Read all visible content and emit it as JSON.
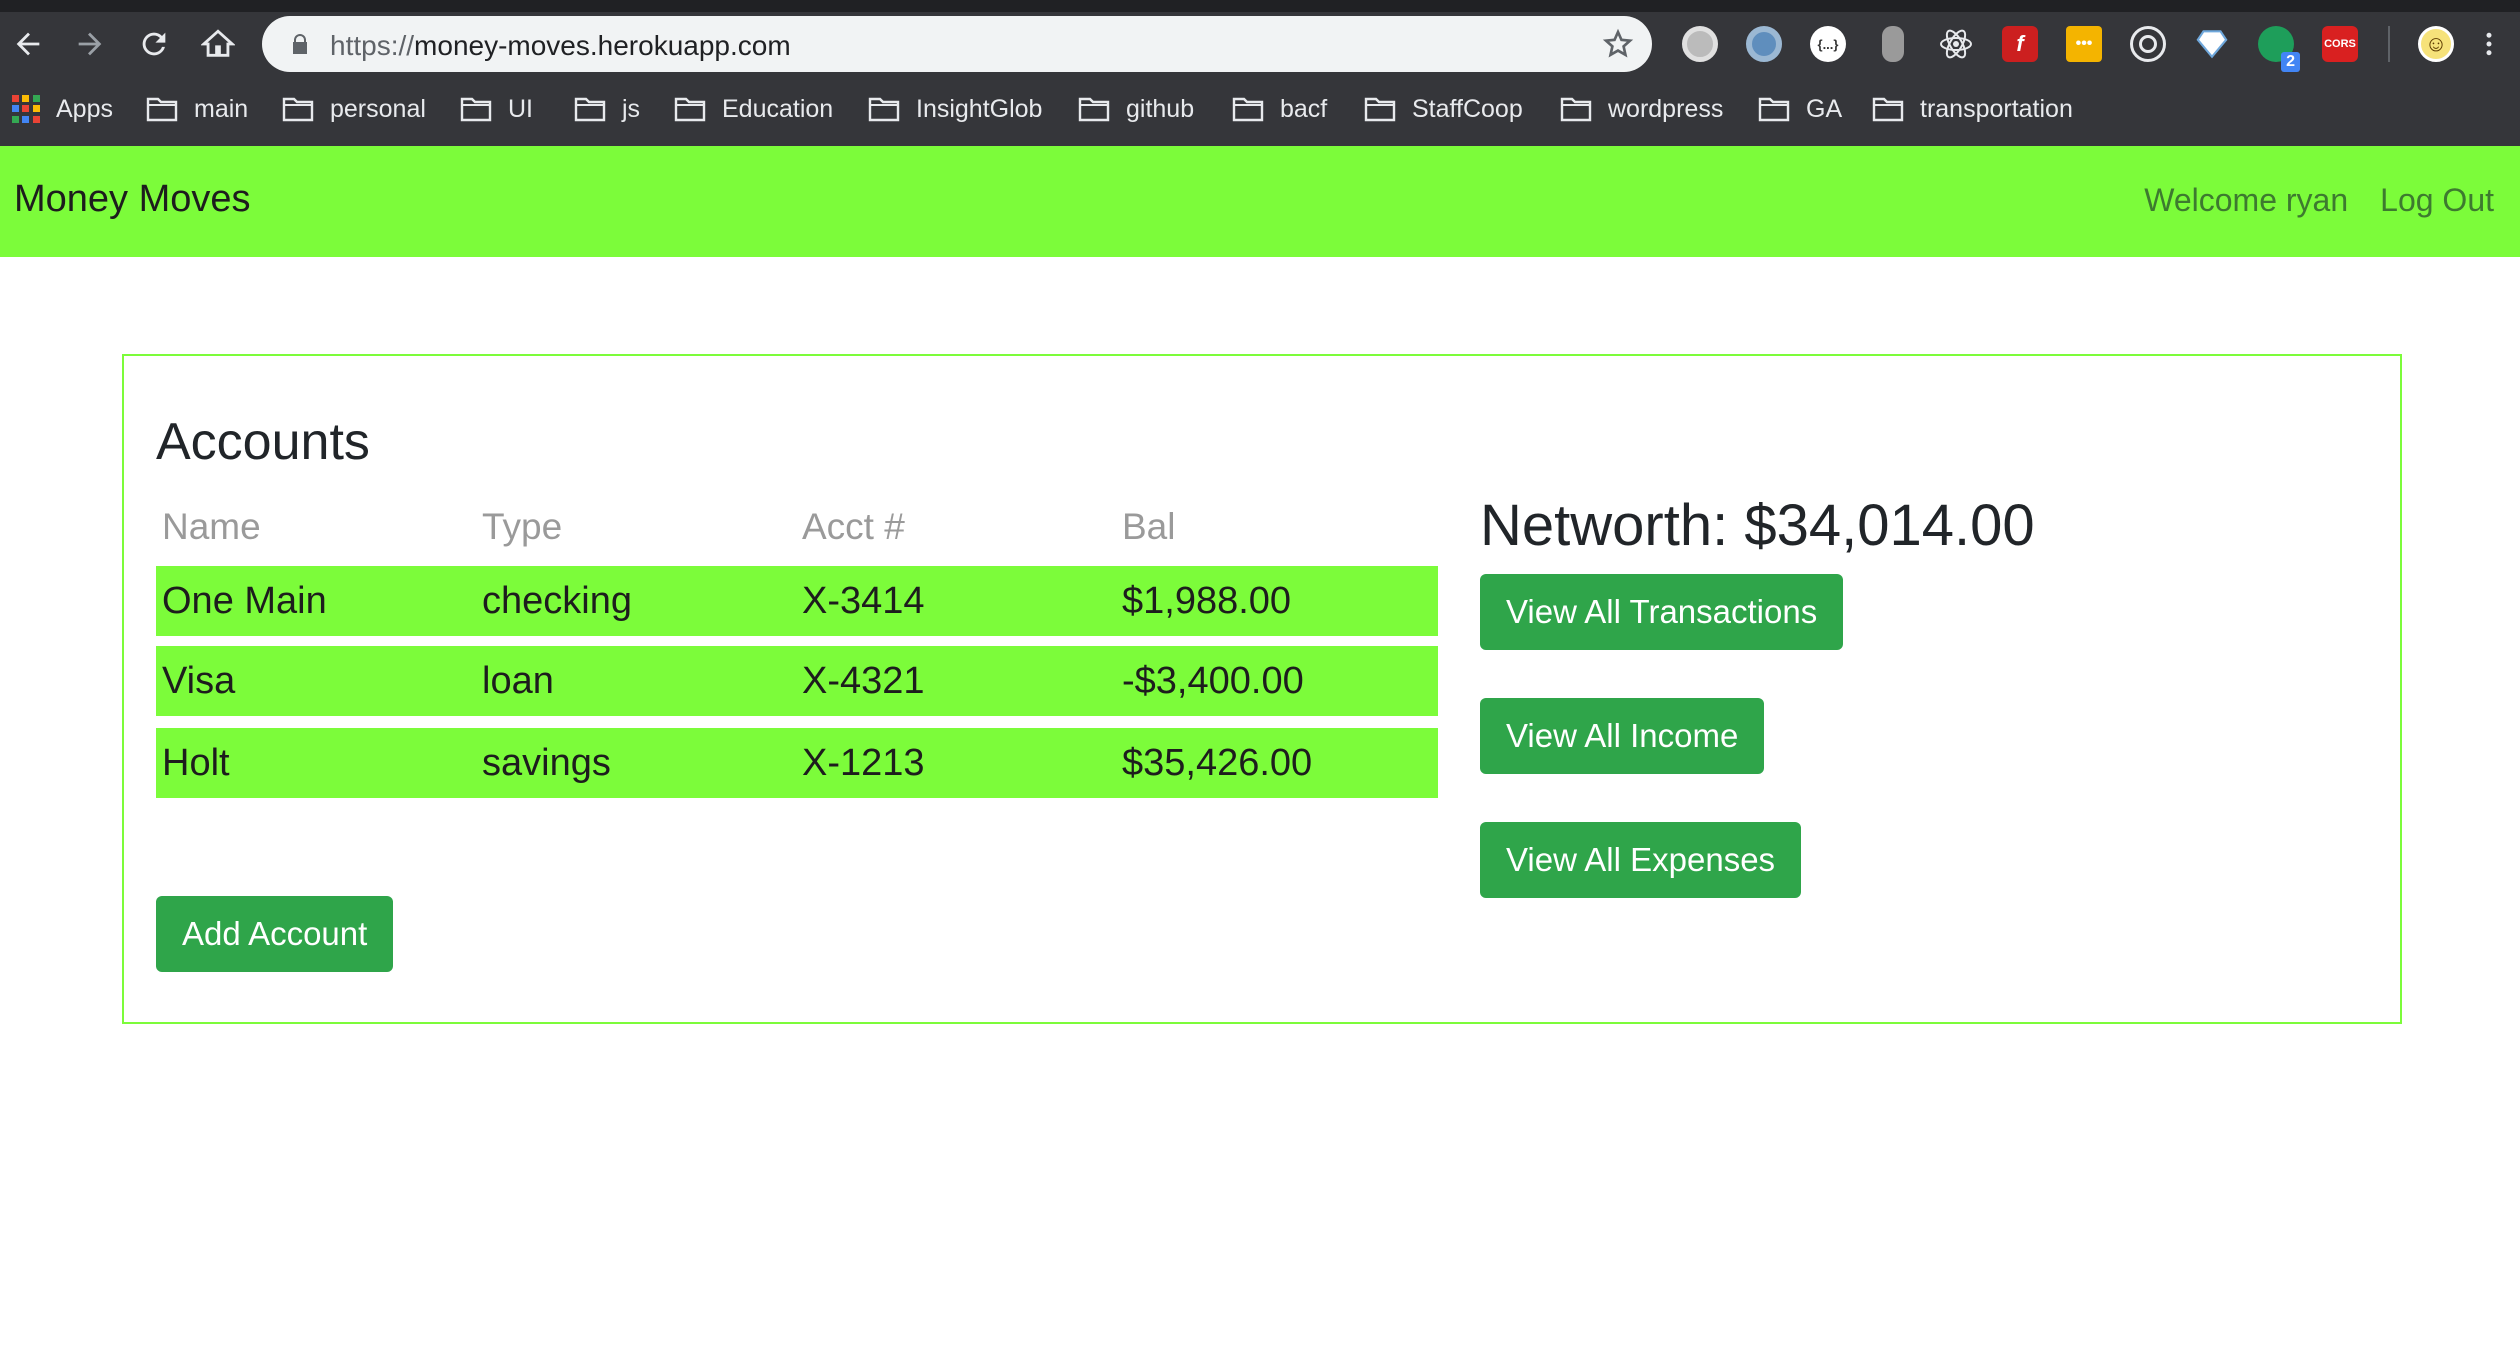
{
  "browser": {
    "url_scheme": "https://",
    "url_host": "money-moves.herokuapp.com",
    "bookmarks": [
      {
        "label": "Apps",
        "icon": "apps-grid-icon"
      },
      {
        "label": "main",
        "icon": "folder-icon"
      },
      {
        "label": "personal",
        "icon": "folder-icon"
      },
      {
        "label": "UI",
        "icon": "folder-icon"
      },
      {
        "label": "js",
        "icon": "folder-icon"
      },
      {
        "label": "Education",
        "icon": "folder-icon"
      },
      {
        "label": "InsightGlob",
        "icon": "folder-icon"
      },
      {
        "label": "github",
        "icon": "folder-icon"
      },
      {
        "label": "bacf",
        "icon": "folder-icon"
      },
      {
        "label": "StaffCoop",
        "icon": "folder-icon"
      },
      {
        "label": "wordpress",
        "icon": "folder-icon"
      },
      {
        "label": "GA",
        "icon": "folder-icon"
      },
      {
        "label": "transportation",
        "icon": "folder-icon"
      }
    ],
    "extensions": [
      {
        "name": "extension-1-icon",
        "badge": ""
      },
      {
        "name": "extension-2-icon",
        "badge": ""
      },
      {
        "name": "json-viewer-icon",
        "badge": ""
      },
      {
        "name": "extension-4-icon",
        "badge": ""
      },
      {
        "name": "react-devtools-icon",
        "badge": ""
      },
      {
        "name": "flash-icon",
        "badge": ""
      },
      {
        "name": "extension-7-icon",
        "badge": ""
      },
      {
        "name": "target-icon",
        "badge": ""
      },
      {
        "name": "diamond-icon",
        "badge": ""
      },
      {
        "name": "extension-10-icon",
        "badge": "2"
      },
      {
        "name": "cors-icon",
        "badge": "CORS"
      },
      {
        "name": "profile-avatar-icon",
        "badge": ""
      }
    ]
  },
  "app": {
    "brand": "Money Moves",
    "welcome": "Welcome ryan",
    "logout": "Log Out"
  },
  "accounts": {
    "title": "Accounts",
    "columns": [
      "Name",
      "Type",
      "Acct #",
      "Bal"
    ],
    "rows": [
      {
        "name": "One Main",
        "type": "checking",
        "acct": "X-3414",
        "bal": "$1,988.00"
      },
      {
        "name": "Visa",
        "type": "loan",
        "acct": "X-4321",
        "bal": "-$3,400.00"
      },
      {
        "name": "Holt",
        "type": "savings",
        "acct": "X-1213",
        "bal": "$35,426.00"
      }
    ],
    "add_button": "Add Account"
  },
  "summary": {
    "networth": "Networth: $34,014.00",
    "view_transactions": "View All Transactions",
    "view_income": "View All Income",
    "view_expenses": "View All Expenses"
  },
  "colors": {
    "navbar": "#7cfc3a",
    "row": "#7cfc3a",
    "button": "#2fa54a",
    "nav_link": "#3d7a2f"
  }
}
